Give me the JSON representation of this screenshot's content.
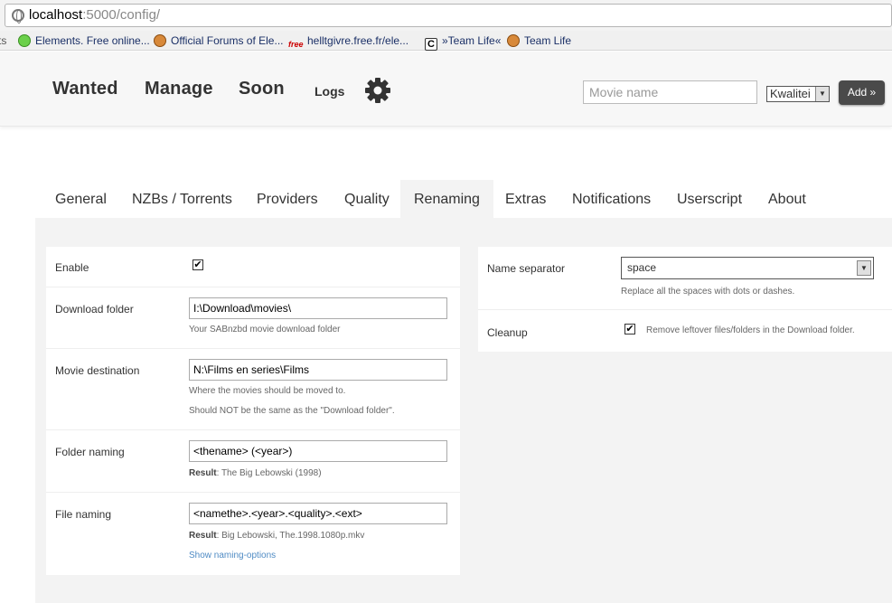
{
  "browser": {
    "url_host": "localhost",
    "url_path": ":5000/config/",
    "bookmarks": [
      {
        "label": "Elements. Free online..."
      },
      {
        "label": "Official Forums of Ele..."
      },
      {
        "label": "helltgivre.free.fr/ele..."
      },
      {
        "label": "»Team Life«"
      },
      {
        "label": "Team Life"
      }
    ]
  },
  "header": {
    "nav": [
      "Wanted",
      "Manage",
      "Soon"
    ],
    "logs_label": "Logs",
    "movie_placeholder": "Movie name",
    "quality_selected": "Kwalitei",
    "add_label": "Add »"
  },
  "tabs": [
    "General",
    "NZBs / Torrents",
    "Providers",
    "Quality",
    "Renaming",
    "Extras",
    "Notifications",
    "Userscript",
    "About"
  ],
  "active_tab": "Renaming",
  "left_panel": {
    "enable_label": "Enable",
    "enable_checked": true,
    "download_folder": {
      "label": "Download folder",
      "value": "I:\\Download\\movies\\",
      "hint": "Your SABnzbd movie download folder"
    },
    "movie_destination": {
      "label": "Movie destination",
      "value": "N:\\Films en series\\Films",
      "hint1": "Where the movies should be moved to.",
      "hint2": "Should NOT be the same as the \"Download folder\"."
    },
    "folder_naming": {
      "label": "Folder naming",
      "value": "<thename> (<year>)",
      "result_label": "Result",
      "result_value": ": The Big Lebowski (1998)"
    },
    "file_naming": {
      "label": "File naming",
      "value": "<namethe>.<year>.<quality>.<ext>",
      "result_label": "Result",
      "result_value": ": Big Lebowski, The.1998.1080p.mkv",
      "options_link": "Show naming-options"
    }
  },
  "right_panel": {
    "separator": {
      "label": "Name separator",
      "value": "space",
      "hint": "Replace all the spaces with dots or dashes."
    },
    "cleanup": {
      "label": "Cleanup",
      "checked": true,
      "hint": "Remove leftover files/folders in the Download folder."
    }
  }
}
